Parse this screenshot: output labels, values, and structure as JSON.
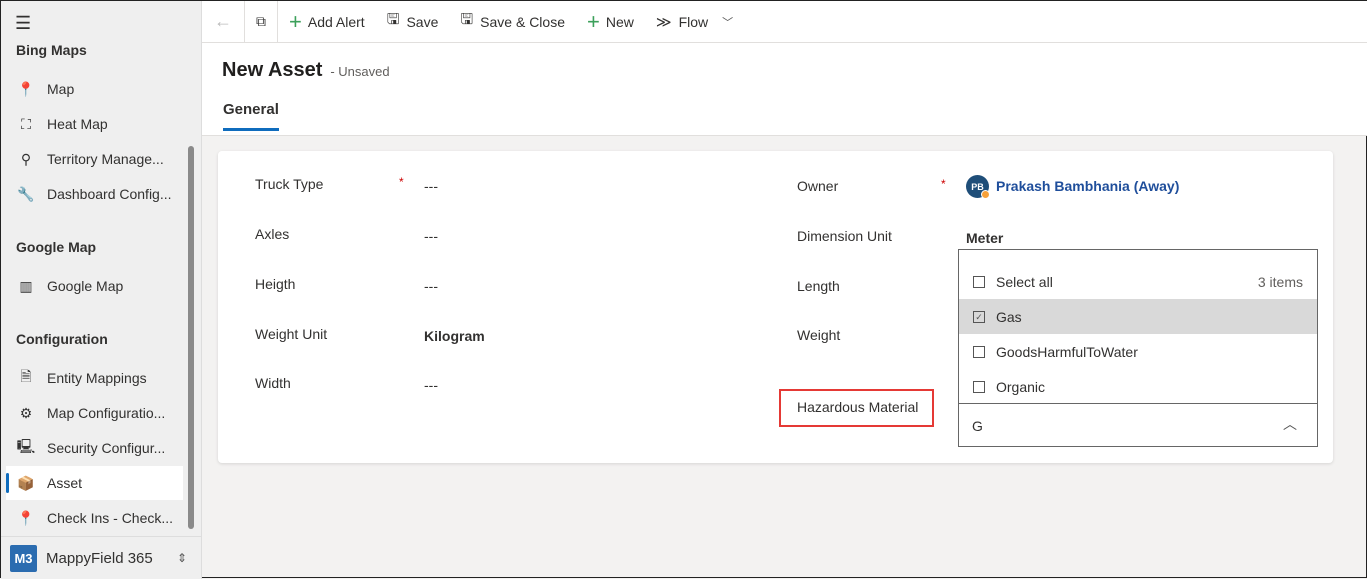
{
  "sidebar": {
    "sections": [
      {
        "title": "Bing Maps",
        "items": [
          "Map",
          "Heat Map",
          "Territory Manage...",
          "Dashboard Config..."
        ]
      },
      {
        "title": "Google Map",
        "items": [
          "Google Map"
        ]
      },
      {
        "title": "Configuration",
        "items": [
          "Entity Mappings",
          "Map Configuratio...",
          "Security Configur...",
          "Asset",
          "Check Ins - Check..."
        ]
      }
    ],
    "selected": "Asset",
    "app": {
      "badge": "M3",
      "name": "MappyField 365"
    }
  },
  "toolbar": {
    "add_alert": "Add Alert",
    "save": "Save",
    "save_close": "Save & Close",
    "new": "New",
    "flow": "Flow"
  },
  "header": {
    "title": "New Asset",
    "status": "- Unsaved",
    "tab": "General"
  },
  "form": {
    "left": [
      {
        "label": "Truck Type",
        "required": true,
        "value": "---"
      },
      {
        "label": "Axles",
        "value": "---"
      },
      {
        "label": "Heigth",
        "value": "---"
      },
      {
        "label": "Weight Unit",
        "value": "Kilogram"
      },
      {
        "label": "Width",
        "value": "---"
      }
    ],
    "right": [
      {
        "label": "Owner",
        "required": true,
        "value": "Prakash Bambhania (Away)",
        "initials": "PB"
      },
      {
        "label": "Dimension Unit",
        "value": "Meter"
      },
      {
        "label": "Length"
      },
      {
        "label": "Weight"
      },
      {
        "label": "Hazardous Material"
      }
    ]
  },
  "dropdown": {
    "select_all": "Select all",
    "count": "3 items",
    "options": [
      {
        "label": "Gas",
        "checked": true
      },
      {
        "label": "GoodsHarmfulToWater",
        "checked": false
      },
      {
        "label": "Organic",
        "checked": false
      }
    ],
    "search_value": "G"
  },
  "colors": {
    "accent": "#0f6cbd",
    "highlight": "#e53935",
    "away": "#f7a13a"
  }
}
